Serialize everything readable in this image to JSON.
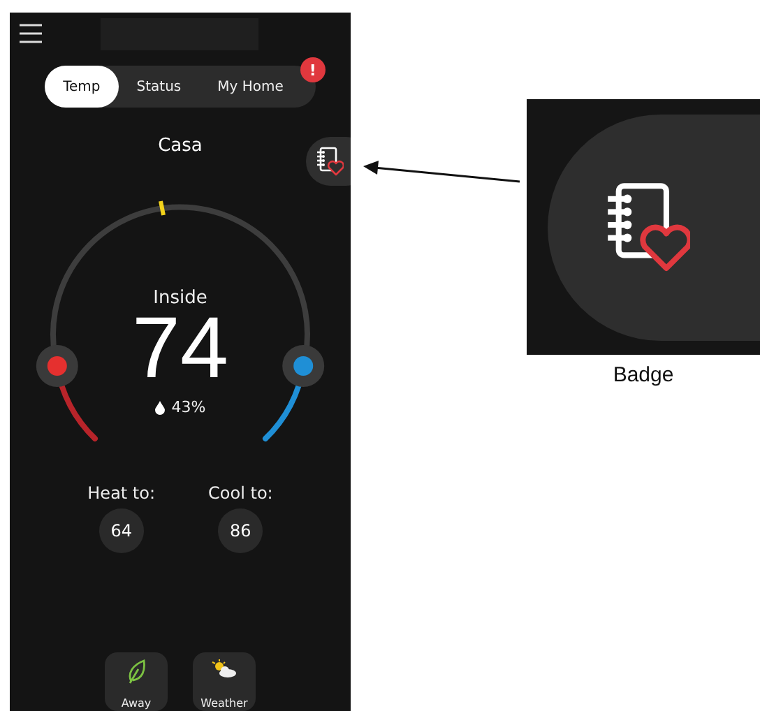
{
  "tabs": [
    {
      "label": "Temp",
      "selected": true
    },
    {
      "label": "Status",
      "selected": false
    },
    {
      "label": "My Home",
      "selected": false
    }
  ],
  "tab_alert": "!",
  "location": "Casa",
  "indoor": {
    "label": "Inside",
    "temperature": "74",
    "humidity": "43%"
  },
  "setpoints": [
    {
      "label": "Heat to:",
      "value": "64"
    },
    {
      "label": "Cool to:",
      "value": "86"
    }
  ],
  "modes": [
    {
      "label": "Away",
      "kind": "away"
    },
    {
      "label": "Weather",
      "kind": "weather"
    }
  ],
  "callout": {
    "label": "Badge"
  }
}
